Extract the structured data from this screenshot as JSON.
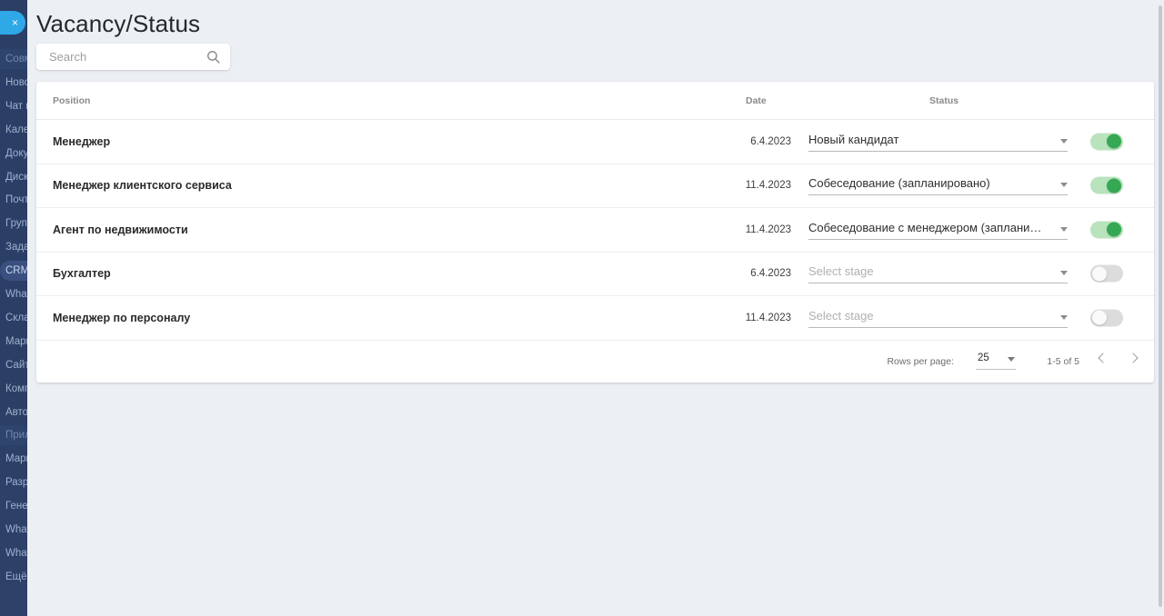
{
  "window": {
    "close_label": "×"
  },
  "sidebar": {
    "items": [
      {
        "label": "Совместная работа",
        "state": "group"
      },
      {
        "label": "Новости",
        "state": "normal"
      },
      {
        "label": "Чат и звонки",
        "state": "normal"
      },
      {
        "label": "Календарь",
        "state": "normal"
      },
      {
        "label": "Документы онлайн",
        "state": "normal"
      },
      {
        "label": "Диск",
        "state": "normal"
      },
      {
        "label": "Почта",
        "state": "normal"
      },
      {
        "label": "Группы",
        "state": "normal"
      },
      {
        "label": "Задачи и Проекты",
        "state": "normal"
      },
      {
        "label": "CRM",
        "state": "active"
      },
      {
        "label": "WhatsApp",
        "state": "normal"
      },
      {
        "label": "Склад",
        "state": "normal"
      },
      {
        "label": "Маркетинг",
        "state": "normal"
      },
      {
        "label": "Сайты",
        "state": "normal"
      },
      {
        "label": "Компания",
        "state": "normal"
      },
      {
        "label": "Автоматизация",
        "state": "normal"
      },
      {
        "label": "Приложения",
        "state": "group"
      },
      {
        "label": "Маркет",
        "state": "normal"
      },
      {
        "label": "Разработчикам",
        "state": "normal"
      },
      {
        "label": "Генератор",
        "state": "normal"
      },
      {
        "label": "WhatsApp",
        "state": "normal"
      },
      {
        "label": "WhatsApp",
        "state": "normal"
      },
      {
        "label": "Ещё",
        "state": "normal"
      }
    ]
  },
  "header": {
    "title": "Vacancy/Status"
  },
  "search": {
    "value": "",
    "placeholder": "Search",
    "icon": "search-icon"
  },
  "table": {
    "columns": [
      {
        "key": "position",
        "label": "Position"
      },
      {
        "key": "date",
        "label": "Date"
      },
      {
        "key": "status",
        "label": "Status"
      }
    ],
    "stage_placeholder": "Select stage",
    "rows": [
      {
        "position": "Менеджер",
        "date": "6.4.2023",
        "stage": "Новый кандидат",
        "stage_empty": false,
        "toggle": true
      },
      {
        "position": "Менеджер клиентского сервиса",
        "date": "11.4.2023",
        "stage": "Собеседование (запланировано)",
        "stage_empty": false,
        "toggle": true
      },
      {
        "position": "Агент по недвижимости",
        "date": "11.4.2023",
        "stage": "Собеседование с менеджером (запланир…",
        "stage_empty": false,
        "toggle": true
      },
      {
        "position": "Бухгалтер",
        "date": "6.4.2023",
        "stage": "Select stage",
        "stage_empty": true,
        "toggle": false
      },
      {
        "position": "Менеджер по персоналу",
        "date": "11.4.2023",
        "stage": "Select stage",
        "stage_empty": true,
        "toggle": false
      }
    ]
  },
  "pagination": {
    "rows_per_page_label": "Rows per page:",
    "rows_per_page_value": "25",
    "range_label": "1-5 of 5",
    "prev_icon": "chevron-left-icon",
    "next_icon": "chevron-right-icon"
  },
  "colors": {
    "accent_blue": "#2fa8e8",
    "sidebar_bg": "#2b3f66",
    "page_bg": "#eceff3",
    "toggle_on_track": "#b9e3bd",
    "toggle_on_knob": "#35a853",
    "toggle_off_track": "#dcdcdc"
  }
}
